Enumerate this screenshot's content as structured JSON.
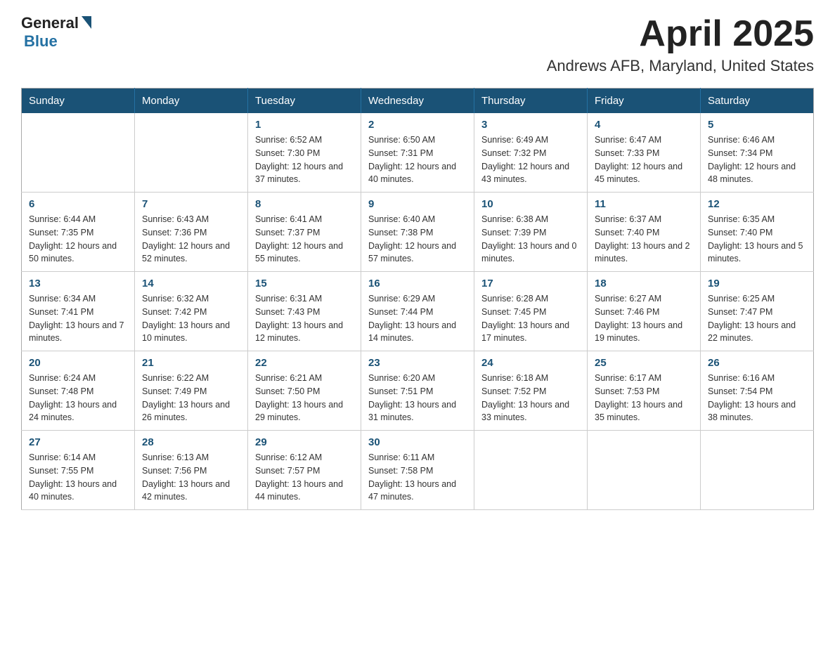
{
  "header": {
    "title": "April 2025",
    "subtitle": "Andrews AFB, Maryland, United States",
    "logo_general": "General",
    "logo_blue": "Blue"
  },
  "days_of_week": [
    "Sunday",
    "Monday",
    "Tuesday",
    "Wednesday",
    "Thursday",
    "Friday",
    "Saturday"
  ],
  "weeks": [
    [
      {
        "day": "",
        "sunrise": "",
        "sunset": "",
        "daylight": ""
      },
      {
        "day": "",
        "sunrise": "",
        "sunset": "",
        "daylight": ""
      },
      {
        "day": "1",
        "sunrise": "Sunrise: 6:52 AM",
        "sunset": "Sunset: 7:30 PM",
        "daylight": "Daylight: 12 hours and 37 minutes."
      },
      {
        "day": "2",
        "sunrise": "Sunrise: 6:50 AM",
        "sunset": "Sunset: 7:31 PM",
        "daylight": "Daylight: 12 hours and 40 minutes."
      },
      {
        "day": "3",
        "sunrise": "Sunrise: 6:49 AM",
        "sunset": "Sunset: 7:32 PM",
        "daylight": "Daylight: 12 hours and 43 minutes."
      },
      {
        "day": "4",
        "sunrise": "Sunrise: 6:47 AM",
        "sunset": "Sunset: 7:33 PM",
        "daylight": "Daylight: 12 hours and 45 minutes."
      },
      {
        "day": "5",
        "sunrise": "Sunrise: 6:46 AM",
        "sunset": "Sunset: 7:34 PM",
        "daylight": "Daylight: 12 hours and 48 minutes."
      }
    ],
    [
      {
        "day": "6",
        "sunrise": "Sunrise: 6:44 AM",
        "sunset": "Sunset: 7:35 PM",
        "daylight": "Daylight: 12 hours and 50 minutes."
      },
      {
        "day": "7",
        "sunrise": "Sunrise: 6:43 AM",
        "sunset": "Sunset: 7:36 PM",
        "daylight": "Daylight: 12 hours and 52 minutes."
      },
      {
        "day": "8",
        "sunrise": "Sunrise: 6:41 AM",
        "sunset": "Sunset: 7:37 PM",
        "daylight": "Daylight: 12 hours and 55 minutes."
      },
      {
        "day": "9",
        "sunrise": "Sunrise: 6:40 AM",
        "sunset": "Sunset: 7:38 PM",
        "daylight": "Daylight: 12 hours and 57 minutes."
      },
      {
        "day": "10",
        "sunrise": "Sunrise: 6:38 AM",
        "sunset": "Sunset: 7:39 PM",
        "daylight": "Daylight: 13 hours and 0 minutes."
      },
      {
        "day": "11",
        "sunrise": "Sunrise: 6:37 AM",
        "sunset": "Sunset: 7:40 PM",
        "daylight": "Daylight: 13 hours and 2 minutes."
      },
      {
        "day": "12",
        "sunrise": "Sunrise: 6:35 AM",
        "sunset": "Sunset: 7:40 PM",
        "daylight": "Daylight: 13 hours and 5 minutes."
      }
    ],
    [
      {
        "day": "13",
        "sunrise": "Sunrise: 6:34 AM",
        "sunset": "Sunset: 7:41 PM",
        "daylight": "Daylight: 13 hours and 7 minutes."
      },
      {
        "day": "14",
        "sunrise": "Sunrise: 6:32 AM",
        "sunset": "Sunset: 7:42 PM",
        "daylight": "Daylight: 13 hours and 10 minutes."
      },
      {
        "day": "15",
        "sunrise": "Sunrise: 6:31 AM",
        "sunset": "Sunset: 7:43 PM",
        "daylight": "Daylight: 13 hours and 12 minutes."
      },
      {
        "day": "16",
        "sunrise": "Sunrise: 6:29 AM",
        "sunset": "Sunset: 7:44 PM",
        "daylight": "Daylight: 13 hours and 14 minutes."
      },
      {
        "day": "17",
        "sunrise": "Sunrise: 6:28 AM",
        "sunset": "Sunset: 7:45 PM",
        "daylight": "Daylight: 13 hours and 17 minutes."
      },
      {
        "day": "18",
        "sunrise": "Sunrise: 6:27 AM",
        "sunset": "Sunset: 7:46 PM",
        "daylight": "Daylight: 13 hours and 19 minutes."
      },
      {
        "day": "19",
        "sunrise": "Sunrise: 6:25 AM",
        "sunset": "Sunset: 7:47 PM",
        "daylight": "Daylight: 13 hours and 22 minutes."
      }
    ],
    [
      {
        "day": "20",
        "sunrise": "Sunrise: 6:24 AM",
        "sunset": "Sunset: 7:48 PM",
        "daylight": "Daylight: 13 hours and 24 minutes."
      },
      {
        "day": "21",
        "sunrise": "Sunrise: 6:22 AM",
        "sunset": "Sunset: 7:49 PM",
        "daylight": "Daylight: 13 hours and 26 minutes."
      },
      {
        "day": "22",
        "sunrise": "Sunrise: 6:21 AM",
        "sunset": "Sunset: 7:50 PM",
        "daylight": "Daylight: 13 hours and 29 minutes."
      },
      {
        "day": "23",
        "sunrise": "Sunrise: 6:20 AM",
        "sunset": "Sunset: 7:51 PM",
        "daylight": "Daylight: 13 hours and 31 minutes."
      },
      {
        "day": "24",
        "sunrise": "Sunrise: 6:18 AM",
        "sunset": "Sunset: 7:52 PM",
        "daylight": "Daylight: 13 hours and 33 minutes."
      },
      {
        "day": "25",
        "sunrise": "Sunrise: 6:17 AM",
        "sunset": "Sunset: 7:53 PM",
        "daylight": "Daylight: 13 hours and 35 minutes."
      },
      {
        "day": "26",
        "sunrise": "Sunrise: 6:16 AM",
        "sunset": "Sunset: 7:54 PM",
        "daylight": "Daylight: 13 hours and 38 minutes."
      }
    ],
    [
      {
        "day": "27",
        "sunrise": "Sunrise: 6:14 AM",
        "sunset": "Sunset: 7:55 PM",
        "daylight": "Daylight: 13 hours and 40 minutes."
      },
      {
        "day": "28",
        "sunrise": "Sunrise: 6:13 AM",
        "sunset": "Sunset: 7:56 PM",
        "daylight": "Daylight: 13 hours and 42 minutes."
      },
      {
        "day": "29",
        "sunrise": "Sunrise: 6:12 AM",
        "sunset": "Sunset: 7:57 PM",
        "daylight": "Daylight: 13 hours and 44 minutes."
      },
      {
        "day": "30",
        "sunrise": "Sunrise: 6:11 AM",
        "sunset": "Sunset: 7:58 PM",
        "daylight": "Daylight: 13 hours and 47 minutes."
      },
      {
        "day": "",
        "sunrise": "",
        "sunset": "",
        "daylight": ""
      },
      {
        "day": "",
        "sunrise": "",
        "sunset": "",
        "daylight": ""
      },
      {
        "day": "",
        "sunrise": "",
        "sunset": "",
        "daylight": ""
      }
    ]
  ]
}
